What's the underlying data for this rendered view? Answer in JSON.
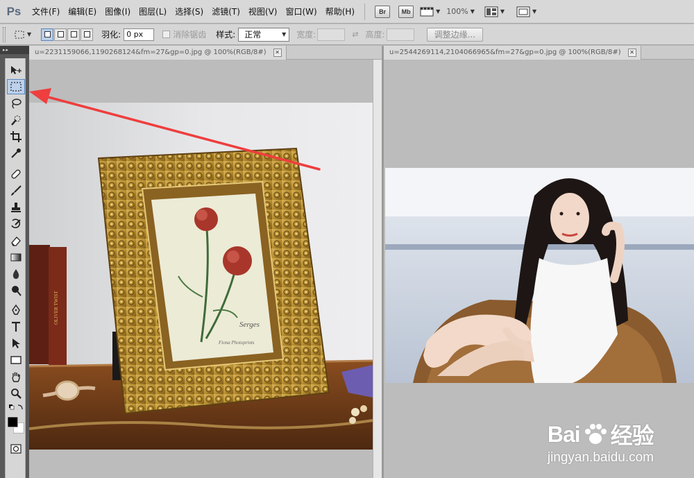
{
  "app": {
    "logo": "Ps",
    "menus": [
      "文件(F)",
      "编辑(E)",
      "图像(I)",
      "图层(L)",
      "选择(S)",
      "滤镜(T)",
      "视图(V)",
      "窗口(W)",
      "帮助(H)"
    ],
    "bridge_label": "Br",
    "minibridge_label": "Mb",
    "zoom": "100%"
  },
  "options": {
    "feather_label": "羽化:",
    "feather_value": "0 px",
    "antialias_label": "消除锯齿",
    "style_label": "样式:",
    "style_value": "正常",
    "width_label": "宽度:",
    "height_label": "高度:",
    "refine_button": "调整边缘..."
  },
  "tools": {
    "active": "rect-marquee-tool"
  },
  "documents": [
    {
      "title": "u=2231159066,1190268124&fm=27&gp=0.jpg @ 100%(RGB/8#)"
    },
    {
      "title": "u=2544269114,2104066965&fm=27&gp=0.jpg @ 100%(RGB/8#)"
    }
  ],
  "photo_left": {
    "frame_text_1": "Serges",
    "frame_text_2": "Fiona Photoprints"
  },
  "watermark": {
    "brand_left": "Bai",
    "brand_right": "经验",
    "url": "jingyan.baidu.com"
  },
  "colors": {
    "annotation_arrow": "#ee3e3e",
    "active_tool_bg": "#bcd1eb",
    "frame_gold": "#b8902f"
  }
}
